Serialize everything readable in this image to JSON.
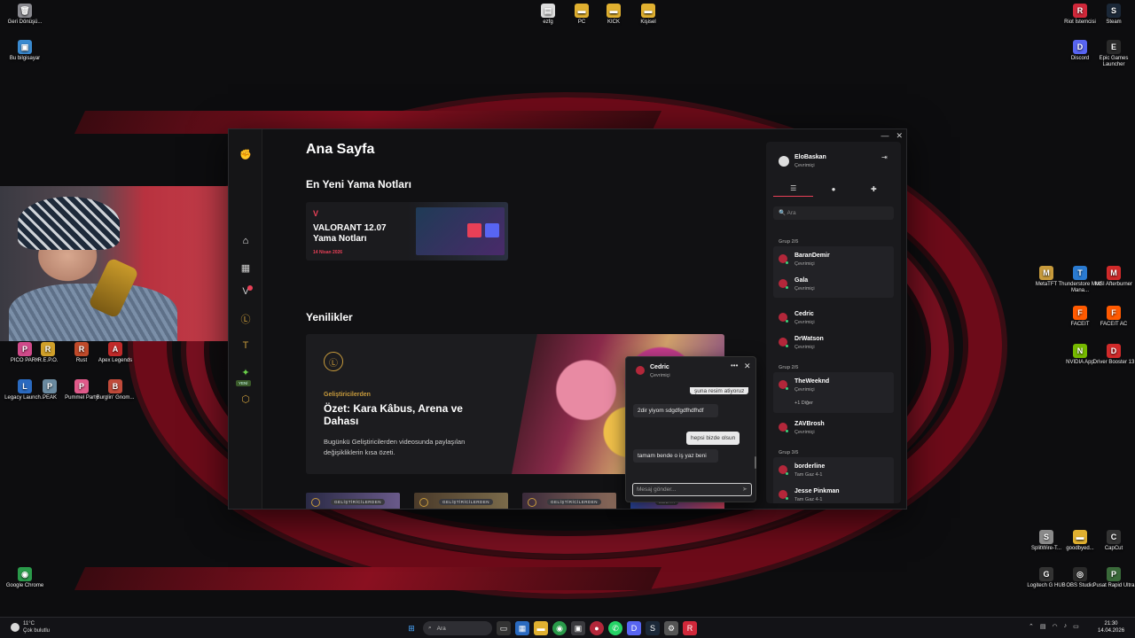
{
  "desktop": {
    "icons_left": [
      {
        "label": "Geri Dönüşü...",
        "color": "#8a8a90",
        "glyph": "🗑"
      },
      {
        "label": "Bu bilgisayar",
        "color": "#3a8ad0",
        "glyph": "▣"
      },
      {
        "label": "PICO PARK",
        "color": "#d04a8a",
        "glyph": "P"
      },
      {
        "label": "R.E.P.O.",
        "color": "#d0a02a",
        "glyph": "R"
      },
      {
        "label": "Rust",
        "color": "#c04a2a",
        "glyph": "R"
      },
      {
        "label": "Apex Legends",
        "color": "#c02a2a",
        "glyph": "A"
      },
      {
        "label": "Legacy Launch...",
        "color": "#2a6ac0",
        "glyph": "L"
      },
      {
        "label": "PEAK",
        "color": "#6a8aa0",
        "glyph": "P"
      },
      {
        "label": "Pummel Party",
        "color": "#e05a8a",
        "glyph": "P"
      },
      {
        "label": "Burglin' Gnom...",
        "color": "#c04a3a",
        "glyph": "B"
      },
      {
        "label": "Google Chrome",
        "color": "#2a9a4a",
        "glyph": "◉"
      }
    ],
    "icons_top": [
      {
        "label": "ezfg",
        "color": "#ddd",
        "glyph": "▤"
      },
      {
        "label": "PC",
        "color": "#e0b030",
        "glyph": "▬"
      },
      {
        "label": "KICK",
        "color": "#e0b030",
        "glyph": "▬"
      },
      {
        "label": "Kişisel",
        "color": "#e0b030",
        "glyph": "▬"
      }
    ],
    "icons_right": [
      {
        "label": "Riot İstemcisi",
        "color": "#d0283a",
        "glyph": "R"
      },
      {
        "label": "Steam",
        "color": "#1b2838",
        "glyph": "S"
      },
      {
        "label": "Discord",
        "color": "#5865f2",
        "glyph": "D"
      },
      {
        "label": "Epic Games Launcher",
        "color": "#2a2a2a",
        "glyph": "E"
      },
      {
        "label": "MetaTFT",
        "color": "#c89b3c",
        "glyph": "M"
      },
      {
        "label": "Thunderstore Mod Mana...",
        "color": "#2a7ad0",
        "glyph": "T"
      },
      {
        "label": "MSI Afterburner",
        "color": "#d02a2a",
        "glyph": "M"
      },
      {
        "label": "FACEIT",
        "color": "#ff5a00",
        "glyph": "F"
      },
      {
        "label": "FACEIT AC",
        "color": "#ff5a00",
        "glyph": "F"
      },
      {
        "label": "NVIDIA App",
        "color": "#76b900",
        "glyph": "N"
      },
      {
        "label": "Driver Booster 13",
        "color": "#d02a2a",
        "glyph": "D"
      },
      {
        "label": "SplitWire-T...",
        "color": "#8a8a8a",
        "glyph": "S"
      },
      {
        "label": "goodbyed...",
        "color": "#e0b030",
        "glyph": "▬"
      },
      {
        "label": "CapCut",
        "color": "#333",
        "glyph": "C"
      },
      {
        "label": "Logitech G HUB",
        "color": "#333",
        "glyph": "G"
      },
      {
        "label": "OBS Studio",
        "color": "#2a2a2a",
        "glyph": "◎"
      },
      {
        "label": "Pusat Rapid Ultra",
        "color": "#3a6a3a",
        "glyph": "P"
      }
    ]
  },
  "app": {
    "window_controls": [
      "—",
      "✕"
    ],
    "rail": {
      "icons": [
        "riot-logo",
        "home-icon",
        "library-icon",
        "valorant-icon",
        "lol-icon",
        "tft-icon",
        "2xko-icon",
        "wild-rift-icon"
      ],
      "new_tag": "YENİ"
    },
    "page_title": "Ana Sayfa",
    "patch_section_title": "En Yeni Yama Notları",
    "patch_card": {
      "game_logo": "V",
      "title": "VALORANT 12.07 Yama Notları",
      "date": "14 Nisan 2026"
    },
    "news_section_title": "Yenilikler",
    "news_card": {
      "category": "Geliştiricilerden",
      "title": "Özet: Kara Kâbus, Arena ve Dahası",
      "description": "Bugünkü Geliştiricilerden videosunda paylaşılan değişikliklerin kısa özeti."
    },
    "thumbnails": [
      "GELİŞTİRİCİLERDEN",
      "GELİŞTİRİCİLERDEN",
      "GELİŞTİRİCİLERDEN",
      "MEDYA"
    ]
  },
  "chat": {
    "name": "Cedric",
    "status": "Çevrimiçi",
    "messages": [
      {
        "dir": "out",
        "text": "şuna resim atiyoruz"
      },
      {
        "dir": "in",
        "text": "2dir yiyom sdgdfgdfhdfhdf"
      },
      {
        "dir": "out",
        "text": "hepsi bizde olsun"
      },
      {
        "dir": "in",
        "text": "tamam bende o iş yaz beni"
      }
    ],
    "input_placeholder": "Mesaj gönder..."
  },
  "friends": {
    "me": {
      "name": "EloBaskan",
      "status": "Çevrimiçi"
    },
    "search_placeholder": "Ara",
    "groups": [
      {
        "label": "Grup 2/5",
        "members": [
          {
            "name": "BaranDemir",
            "status": "Çevrimiçi"
          },
          {
            "name": "Gala",
            "status": "Çevrimiçi"
          }
        ]
      },
      {
        "label": "",
        "members": [
          {
            "name": "Cedric",
            "status": "Çevrimiçi"
          },
          {
            "name": "DrWatson",
            "status": "Çevrimiçi"
          }
        ]
      },
      {
        "label": "Grup 2/5",
        "members": [
          {
            "name": "TheWeeknd",
            "status": "Çevrimiçi"
          }
        ],
        "more": "+1 Diğer"
      },
      {
        "label": "",
        "members": [
          {
            "name": "ZAVBrosh",
            "status": "Çevrimiçi"
          }
        ]
      },
      {
        "label": "Grup 3/5",
        "members": [
          {
            "name": "borderline",
            "status": "Tam Gaz 4-1"
          },
          {
            "name": "Jesse Pinkman",
            "status": "Tam Gaz 4-1"
          }
        ]
      }
    ]
  },
  "taskbar": {
    "weather_temp": "11°C",
    "weather_desc": "Çok bulutlu",
    "search_placeholder": "Ara",
    "time": "21:30",
    "date": "14.04.2026"
  }
}
